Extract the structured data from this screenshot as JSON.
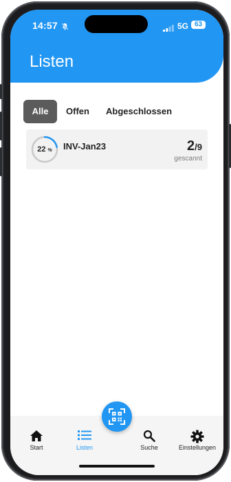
{
  "status_bar": {
    "time": "14:57",
    "network": "5G",
    "battery": "63"
  },
  "header": {
    "title": "Listen"
  },
  "filter_tabs": [
    {
      "label": "Alle",
      "active": true
    },
    {
      "label": "Offen",
      "active": false
    },
    {
      "label": "Abgeschlossen",
      "active": false
    }
  ],
  "lists": [
    {
      "name": "INV-Jan23",
      "percent_value": "22",
      "percent_unit": "%",
      "progress": 0.22,
      "scanned": "2",
      "total": "/9",
      "scanned_label": "gescannt"
    }
  ],
  "bottom_nav": [
    {
      "label": "Start",
      "icon": "home-icon",
      "active": false
    },
    {
      "label": "Listen",
      "icon": "list-icon",
      "active": true
    },
    {
      "label": "Suche",
      "icon": "search-icon",
      "active": false
    },
    {
      "label": "Einstellungen",
      "icon": "gear-icon",
      "active": false
    }
  ],
  "fab": {
    "icon": "qr-scan-icon"
  },
  "colors": {
    "primary": "#2196f3",
    "active_tab": "#5b5b5b",
    "card": "#f2f2f2"
  }
}
